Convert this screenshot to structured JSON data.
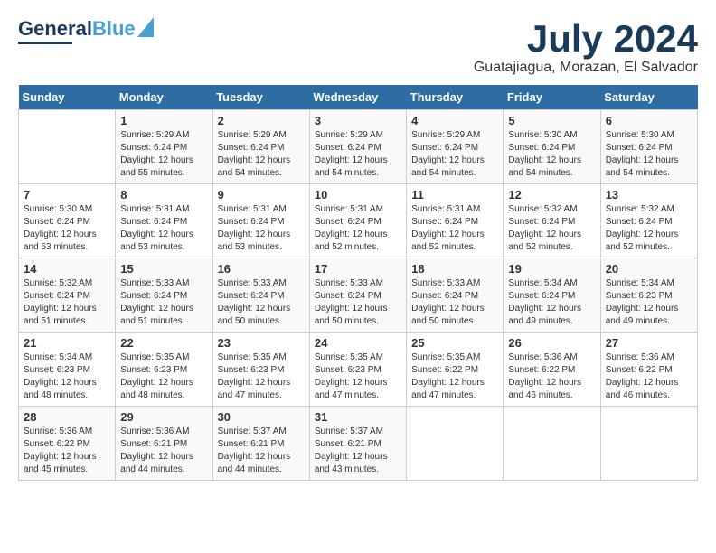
{
  "logo": {
    "line1": "General",
    "line2": "Blue"
  },
  "title": "July 2024",
  "location": "Guatajiagua, Morazan, El Salvador",
  "days_of_week": [
    "Sunday",
    "Monday",
    "Tuesday",
    "Wednesday",
    "Thursday",
    "Friday",
    "Saturday"
  ],
  "weeks": [
    [
      {
        "day": "",
        "info": ""
      },
      {
        "day": "1",
        "info": "Sunrise: 5:29 AM\nSunset: 6:24 PM\nDaylight: 12 hours\nand 55 minutes."
      },
      {
        "day": "2",
        "info": "Sunrise: 5:29 AM\nSunset: 6:24 PM\nDaylight: 12 hours\nand 54 minutes."
      },
      {
        "day": "3",
        "info": "Sunrise: 5:29 AM\nSunset: 6:24 PM\nDaylight: 12 hours\nand 54 minutes."
      },
      {
        "day": "4",
        "info": "Sunrise: 5:29 AM\nSunset: 6:24 PM\nDaylight: 12 hours\nand 54 minutes."
      },
      {
        "day": "5",
        "info": "Sunrise: 5:30 AM\nSunset: 6:24 PM\nDaylight: 12 hours\nand 54 minutes."
      },
      {
        "day": "6",
        "info": "Sunrise: 5:30 AM\nSunset: 6:24 PM\nDaylight: 12 hours\nand 54 minutes."
      }
    ],
    [
      {
        "day": "7",
        "info": "Sunrise: 5:30 AM\nSunset: 6:24 PM\nDaylight: 12 hours\nand 53 minutes."
      },
      {
        "day": "8",
        "info": "Sunrise: 5:31 AM\nSunset: 6:24 PM\nDaylight: 12 hours\nand 53 minutes."
      },
      {
        "day": "9",
        "info": "Sunrise: 5:31 AM\nSunset: 6:24 PM\nDaylight: 12 hours\nand 53 minutes."
      },
      {
        "day": "10",
        "info": "Sunrise: 5:31 AM\nSunset: 6:24 PM\nDaylight: 12 hours\nand 52 minutes."
      },
      {
        "day": "11",
        "info": "Sunrise: 5:31 AM\nSunset: 6:24 PM\nDaylight: 12 hours\nand 52 minutes."
      },
      {
        "day": "12",
        "info": "Sunrise: 5:32 AM\nSunset: 6:24 PM\nDaylight: 12 hours\nand 52 minutes."
      },
      {
        "day": "13",
        "info": "Sunrise: 5:32 AM\nSunset: 6:24 PM\nDaylight: 12 hours\nand 52 minutes."
      }
    ],
    [
      {
        "day": "14",
        "info": "Sunrise: 5:32 AM\nSunset: 6:24 PM\nDaylight: 12 hours\nand 51 minutes."
      },
      {
        "day": "15",
        "info": "Sunrise: 5:33 AM\nSunset: 6:24 PM\nDaylight: 12 hours\nand 51 minutes."
      },
      {
        "day": "16",
        "info": "Sunrise: 5:33 AM\nSunset: 6:24 PM\nDaylight: 12 hours\nand 50 minutes."
      },
      {
        "day": "17",
        "info": "Sunrise: 5:33 AM\nSunset: 6:24 PM\nDaylight: 12 hours\nand 50 minutes."
      },
      {
        "day": "18",
        "info": "Sunrise: 5:33 AM\nSunset: 6:24 PM\nDaylight: 12 hours\nand 50 minutes."
      },
      {
        "day": "19",
        "info": "Sunrise: 5:34 AM\nSunset: 6:24 PM\nDaylight: 12 hours\nand 49 minutes."
      },
      {
        "day": "20",
        "info": "Sunrise: 5:34 AM\nSunset: 6:23 PM\nDaylight: 12 hours\nand 49 minutes."
      }
    ],
    [
      {
        "day": "21",
        "info": "Sunrise: 5:34 AM\nSunset: 6:23 PM\nDaylight: 12 hours\nand 48 minutes."
      },
      {
        "day": "22",
        "info": "Sunrise: 5:35 AM\nSunset: 6:23 PM\nDaylight: 12 hours\nand 48 minutes."
      },
      {
        "day": "23",
        "info": "Sunrise: 5:35 AM\nSunset: 6:23 PM\nDaylight: 12 hours\nand 47 minutes."
      },
      {
        "day": "24",
        "info": "Sunrise: 5:35 AM\nSunset: 6:23 PM\nDaylight: 12 hours\nand 47 minutes."
      },
      {
        "day": "25",
        "info": "Sunrise: 5:35 AM\nSunset: 6:22 PM\nDaylight: 12 hours\nand 47 minutes."
      },
      {
        "day": "26",
        "info": "Sunrise: 5:36 AM\nSunset: 6:22 PM\nDaylight: 12 hours\nand 46 minutes."
      },
      {
        "day": "27",
        "info": "Sunrise: 5:36 AM\nSunset: 6:22 PM\nDaylight: 12 hours\nand 46 minutes."
      }
    ],
    [
      {
        "day": "28",
        "info": "Sunrise: 5:36 AM\nSunset: 6:22 PM\nDaylight: 12 hours\nand 45 minutes."
      },
      {
        "day": "29",
        "info": "Sunrise: 5:36 AM\nSunset: 6:21 PM\nDaylight: 12 hours\nand 44 minutes."
      },
      {
        "day": "30",
        "info": "Sunrise: 5:37 AM\nSunset: 6:21 PM\nDaylight: 12 hours\nand 44 minutes."
      },
      {
        "day": "31",
        "info": "Sunrise: 5:37 AM\nSunset: 6:21 PM\nDaylight: 12 hours\nand 43 minutes."
      },
      {
        "day": "",
        "info": ""
      },
      {
        "day": "",
        "info": ""
      },
      {
        "day": "",
        "info": ""
      }
    ]
  ]
}
